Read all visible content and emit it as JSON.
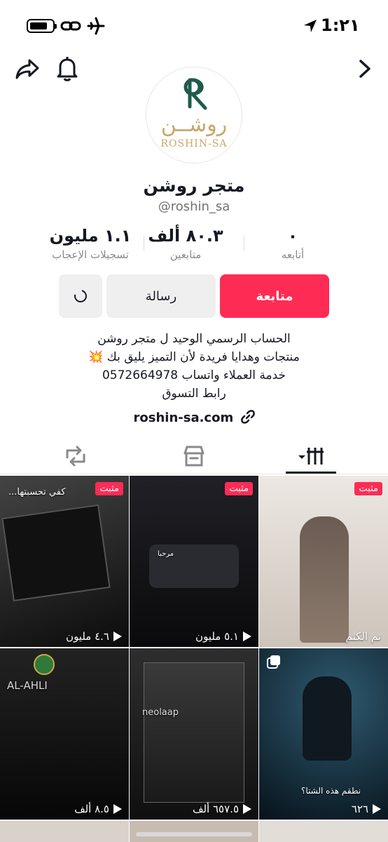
{
  "status_bar": {
    "time": "1:٢١"
  },
  "profile": {
    "logo_ar": "روشــن",
    "logo_en": "ROSHIN-SA",
    "display_name": "متجر روشن",
    "username": "@roshin_sa"
  },
  "stats": {
    "following": {
      "value": "٠",
      "label": "أتابعه"
    },
    "followers": {
      "value": "٨٠.٣ ألف",
      "label": "متابعين"
    },
    "likes": {
      "value": "١.١ مليون",
      "label": "تسجيلات الإعجاب"
    }
  },
  "actions": {
    "follow": "متابعة",
    "message": "رسالة"
  },
  "bio": {
    "lines": [
      "الحساب الرسمي الوحيد ل متجر روشن",
      "منتجات وهدايا فريدة لأن التميز يليق بك 💥",
      "خدمة العملاء واتساب 0572664978",
      "رابط التسوق"
    ],
    "website": "roshin-sa.com"
  },
  "tabs": [
    "videos-tab",
    "shop-tab",
    "reposts-tab"
  ],
  "grid": [
    {
      "pinned": "مثبت",
      "views": "٤.٦ مليون",
      "caption": "كفي تحسبتها...",
      "colors": [
        "#3a3a3a",
        "#0c0c0c"
      ]
    },
    {
      "pinned": "مثبت",
      "views": "٥.١ مليون",
      "caption": "مرحبا",
      "colors": [
        "#1b1b1f",
        "#0a0a0c"
      ]
    },
    {
      "pinned": "مثبت",
      "views": "تم الكتم",
      "caption": "",
      "colors": [
        "#e8e4df",
        "#c9bfb4"
      ]
    },
    {
      "pinned": "",
      "views": "٨.٥ ألف",
      "caption": "AL-AHLI",
      "colors": [
        "#1c1c1c",
        "#080808"
      ]
    },
    {
      "pinned": "",
      "views": "٦٥٧.٥ ألف",
      "caption": "neolaap",
      "colors": [
        "#2a2a2a",
        "#111111"
      ]
    },
    {
      "pinned": "",
      "views": "٦٢٦",
      "caption": "نطقم هذه الشتا؟",
      "colors": [
        "#1d3340",
        "#07121a"
      ]
    }
  ],
  "colors": {
    "accent": "#fe2c55",
    "gold": "#c9a76a",
    "text": "#161823"
  }
}
